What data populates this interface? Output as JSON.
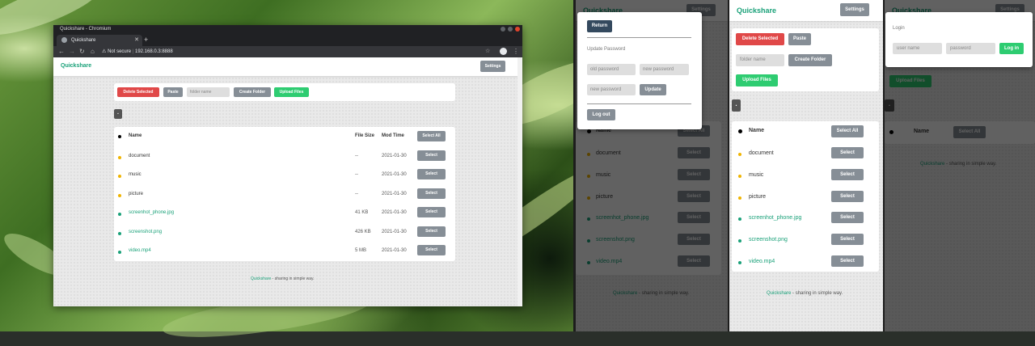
{
  "window": {
    "title": "Quickshare - Chromium",
    "tab_title": "Quickshare",
    "not_secure": "Not secure",
    "url": "192.168.0.3:8888"
  },
  "app": {
    "brand": "Quickshare",
    "settings": "Settings"
  },
  "toolbar": {
    "delete": "Delete Selected",
    "paste": "Paste",
    "folder_placeholder": "folder name",
    "create": "Create Folder",
    "upload": "Upload Files"
  },
  "breadcrumb": ".",
  "table": {
    "name": "Name",
    "size": "File Size",
    "time": "Mod Time",
    "select_all": "Select All",
    "select": "Select",
    "rows": [
      {
        "name": "document",
        "size": "--",
        "time": "2021-01-30",
        "kind": "folder"
      },
      {
        "name": "music",
        "size": "--",
        "time": "2021-01-30",
        "kind": "folder"
      },
      {
        "name": "picture",
        "size": "--",
        "time": "2021-01-30",
        "kind": "folder"
      },
      {
        "name": "screenhot_phone.jpg",
        "size": "41 KB",
        "time": "2021-01-30",
        "kind": "file"
      },
      {
        "name": "screenshot.png",
        "size": "426 KB",
        "time": "2021-01-30",
        "kind": "file"
      },
      {
        "name": "video.mp4",
        "size": "5 MB",
        "time": "2021-01-30",
        "kind": "file"
      }
    ]
  },
  "footer": {
    "brand": "Quickshare",
    "tagline": " - sharing in simple way."
  },
  "settings_panel": {
    "return": "Return",
    "update_password": "Update Password",
    "old_placeholder": "old password",
    "new_placeholder": "new password",
    "new2_placeholder": "new password",
    "update": "Update",
    "logout": "Log out"
  },
  "login_panel": {
    "title": "Login",
    "user_placeholder": "user name",
    "pass_placeholder": "password",
    "login": "Log in"
  },
  "colors": {
    "brand": "#1aa179",
    "danger": "#e04848",
    "success": "#2ecc71",
    "neutral": "#868e96",
    "folder_dot": "#f0b400",
    "file_dot": "#1aa179"
  }
}
